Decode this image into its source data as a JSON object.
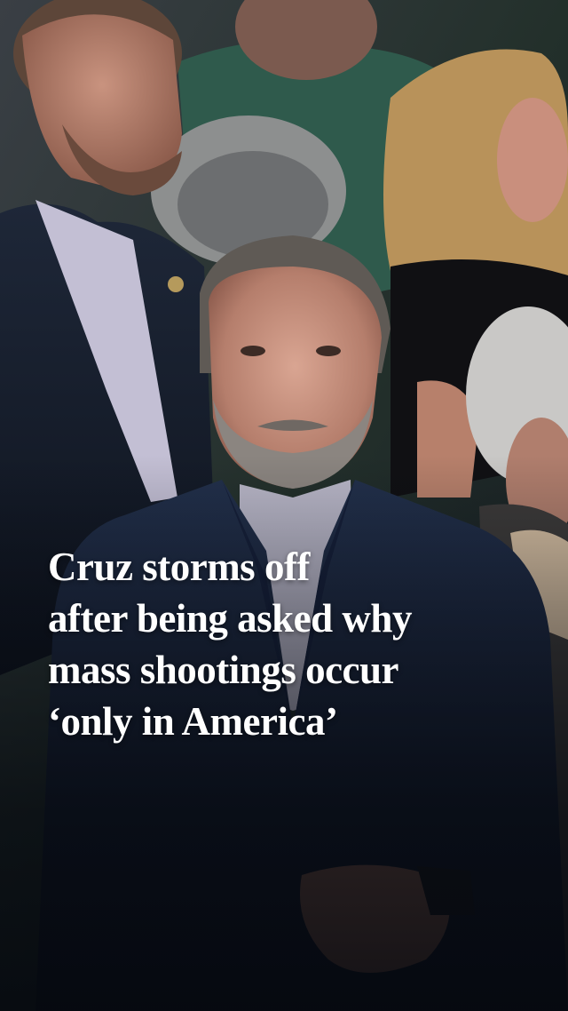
{
  "post": {
    "headline_lines": [
      "Cruz storms off",
      "after being asked why",
      "mass shootings occur",
      "‘only in America’"
    ]
  },
  "photo": {
    "subject": "man-in-navy-suit-with-gray-beard-in-crowd",
    "colors": {
      "suit": "#1c2a44",
      "shirt": "#c9c3d8",
      "background_crowd": "#2f3b35",
      "overlay": "#05080e"
    }
  }
}
